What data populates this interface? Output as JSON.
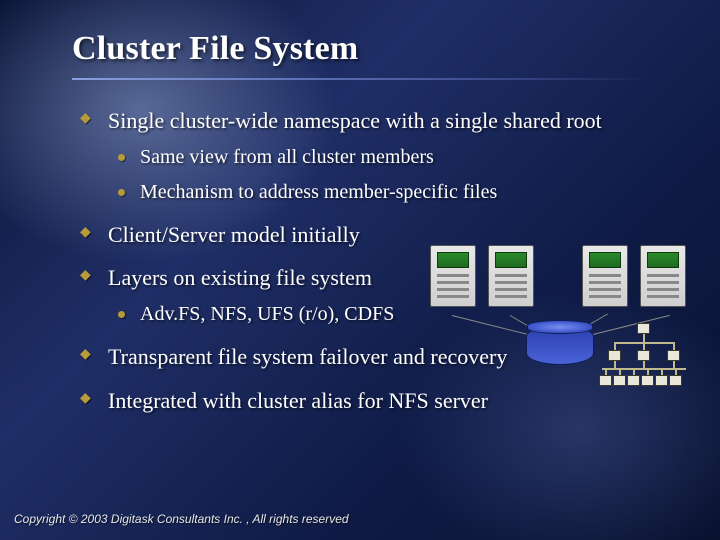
{
  "title": "Cluster File System",
  "bullets": [
    {
      "text": "Single cluster-wide namespace with a single shared root",
      "sub": [
        "Same view from all cluster members",
        "Mechanism to address member-specific files"
      ]
    },
    {
      "text": "Client/Server model initially",
      "sub": []
    },
    {
      "text": "Layers on existing file system",
      "sub": [
        "Adv.FS, NFS, UFS (r/o), CDFS"
      ]
    },
    {
      "text": "Transparent file system failover and recovery",
      "sub": []
    },
    {
      "text": "Integrated with cluster alias for NFS server",
      "sub": []
    }
  ],
  "footer": "Copyright © 2003 Digitask Consultants Inc. , All rights reserved",
  "diagram": {
    "servers": 4,
    "shared_storage": true,
    "namespace_tree": true
  }
}
